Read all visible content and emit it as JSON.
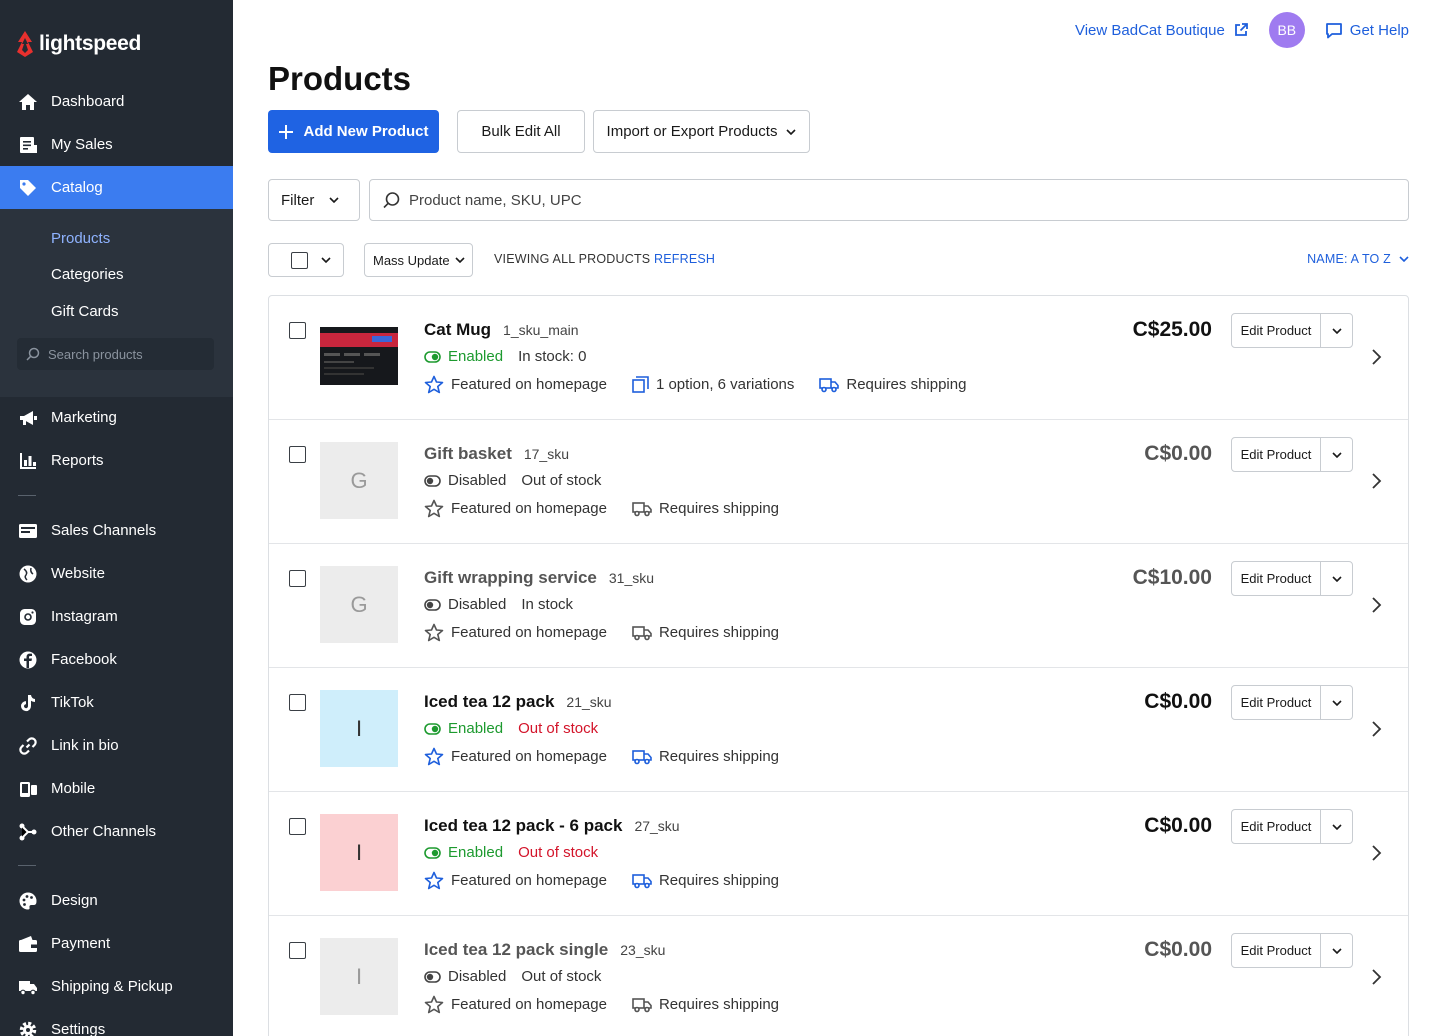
{
  "app": {
    "brand": "lightspeed"
  },
  "colors": {
    "sidebar_bg": "#232a33",
    "accent": "#1f63e3",
    "active_nav": "#3b7cf0",
    "enabled_green": "#1d9a2f",
    "out_of_stock_red": "#d3142a",
    "link_blue": "#1e5fdc",
    "avatar_bg": "#9f7bf0"
  },
  "sidebar": {
    "items": [
      {
        "label": "Dashboard",
        "icon": "home-icon"
      },
      {
        "label": "My Sales",
        "icon": "receipt-icon"
      },
      {
        "label": "Catalog",
        "icon": "tag-icon",
        "active": true
      },
      {
        "label": "Marketing",
        "icon": "megaphone-icon"
      },
      {
        "label": "Reports",
        "icon": "bar-chart-icon"
      },
      {
        "label": "Sales Channels",
        "icon": "storefront-icon"
      },
      {
        "label": "Website",
        "icon": "globe-icon"
      },
      {
        "label": "Instagram",
        "icon": "instagram-icon"
      },
      {
        "label": "Facebook",
        "icon": "facebook-icon"
      },
      {
        "label": "TikTok",
        "icon": "tiktok-icon"
      },
      {
        "label": "Link in bio",
        "icon": "link-icon"
      },
      {
        "label": "Mobile",
        "icon": "mobile-icon"
      },
      {
        "label": "Other Channels",
        "icon": "share-nodes-icon"
      },
      {
        "label": "Design",
        "icon": "palette-icon"
      },
      {
        "label": "Payment",
        "icon": "wallet-icon"
      },
      {
        "label": "Shipping & Pickup",
        "icon": "truck-icon"
      },
      {
        "label": "Settings",
        "icon": "gear-icon"
      }
    ],
    "catalog_sub": [
      {
        "label": "Products",
        "active": true
      },
      {
        "label": "Categories"
      },
      {
        "label": "Gift Cards"
      }
    ],
    "search_placeholder": "Search products"
  },
  "header": {
    "store_link": "View BadCat Boutique",
    "avatar_initials": "BB",
    "help": "Get Help"
  },
  "page": {
    "title": "Products"
  },
  "toolbar": {
    "add_new": "Add New Product",
    "bulk_edit": "Bulk Edit All",
    "import_export": "Import or Export Products"
  },
  "filter": {
    "label": "Filter",
    "search_placeholder": "Product name, SKU, UPC"
  },
  "list_controls": {
    "mass_update": "Mass Update",
    "viewing": "VIEWING ALL PRODUCTS",
    "refresh": "REFRESH",
    "sort": "NAME: A TO Z"
  },
  "common": {
    "edit_product": "Edit Product",
    "featured": "Featured on homepage",
    "requires_shipping": "Requires shipping"
  },
  "products": [
    {
      "name": "Cat Mug",
      "sku": "1_sku_main",
      "status": "Enabled",
      "stock": "In stock: 0",
      "stock_state": "normal",
      "price": "C$25.00",
      "options": "1 option, 6 variations",
      "thumb_letter": "",
      "thumb_type": "image"
    },
    {
      "name": "Gift basket",
      "sku": "17_sku",
      "status": "Disabled",
      "stock": "Out of stock",
      "stock_state": "normal",
      "price": "C$0.00",
      "thumb_letter": "G",
      "thumb_type": "grey"
    },
    {
      "name": "Gift wrapping service",
      "sku": "31_sku",
      "status": "Disabled",
      "stock": "In stock",
      "stock_state": "normal",
      "price": "C$10.00",
      "thumb_letter": "G",
      "thumb_type": "grey"
    },
    {
      "name": "Iced tea 12 pack",
      "sku": "21_sku",
      "status": "Enabled",
      "stock": "Out of stock",
      "stock_state": "oos",
      "price": "C$0.00",
      "thumb_letter": "I",
      "thumb_type": "blue"
    },
    {
      "name": "Iced tea 12 pack - 6 pack",
      "sku": "27_sku",
      "status": "Enabled",
      "stock": "Out of stock",
      "stock_state": "oos",
      "price": "C$0.00",
      "thumb_letter": "I",
      "thumb_type": "pink"
    },
    {
      "name": "Iced tea 12 pack single",
      "sku": "23_sku",
      "status": "Disabled",
      "stock": "Out of stock",
      "stock_state": "normal",
      "price": "C$0.00",
      "thumb_letter": "I",
      "thumb_type": "grey"
    }
  ]
}
